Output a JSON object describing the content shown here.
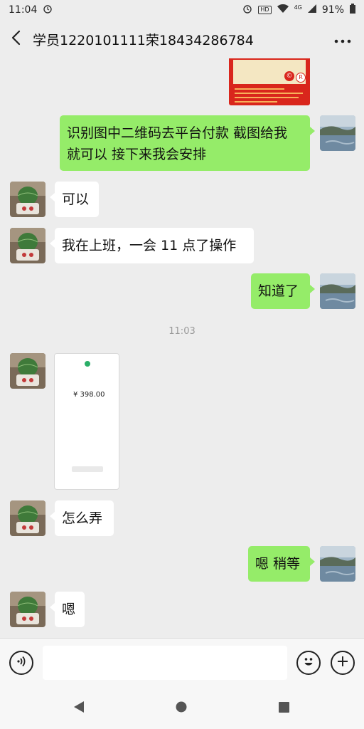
{
  "status": {
    "time": "11:04",
    "network": "4G",
    "battery": "91%"
  },
  "header": {
    "title": "学员1220101111荣18434286784"
  },
  "messages": [
    {
      "side": "out",
      "text_lines": [
        "识别图中二维码去平台付款 截图给我",
        "就可以 接下来我会安排"
      ]
    },
    {
      "side": "in",
      "text": "可以"
    },
    {
      "side": "in",
      "text": "我在上班，一会 11 点了操作"
    },
    {
      "side": "out",
      "text": "知道了"
    },
    {
      "side": "in",
      "text": "怎么弄"
    },
    {
      "side": "out",
      "text": "嗯 稍等"
    },
    {
      "side": "in",
      "text": "嗯"
    }
  ],
  "timestamp": "11:03",
  "payment_screenshot": {
    "amount": "¥ 398.00"
  },
  "icons": {
    "back": "chevron-left-icon",
    "more": "more-dots-icon",
    "voice": "voice-icon",
    "emoji": "emoji-icon",
    "add": "plus-icon"
  },
  "colors": {
    "outgoing_bubble": "#95ec69",
    "incoming_bubble": "#ffffff",
    "background": "#ededed"
  }
}
